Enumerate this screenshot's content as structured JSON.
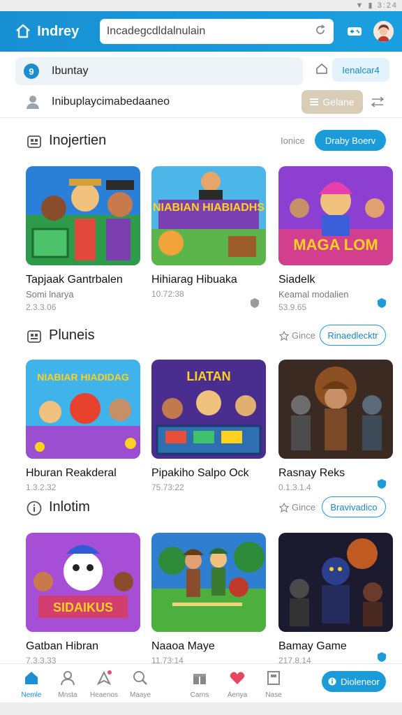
{
  "status_bar": {
    "time": "3:24"
  },
  "app_bar": {
    "title": "Indrey",
    "search_value": "Incadegcdldalnulain"
  },
  "filter": {
    "badge": "9",
    "label": "Ibuntay",
    "chip": "Ienalcar4"
  },
  "user_row": {
    "text": "Inibuplaycimabedaaneo",
    "sort_label": "Gelane"
  },
  "sections": [
    {
      "title": "Inojertien",
      "meta": "Ionice",
      "button": "Draby Boerv",
      "cards": [
        {
          "title": "Tapjaak Gantrbalen",
          "subtitle": "Somi lnarya",
          "number": "2.3.3.06",
          "art_text": ""
        },
        {
          "title": "Hihiarag Hibuaka",
          "subtitle": "",
          "number": "10.72:38",
          "art_text": "NIABIAN HIABIADHS"
        },
        {
          "title": "Siadelk",
          "subtitle": "Keamal modalien",
          "number": "53.9.65",
          "art_text": "MAGA LOM"
        }
      ]
    },
    {
      "title": "Pluneis",
      "meta": "Gince",
      "button": "Rinaedlecktr",
      "cards": [
        {
          "title": "Hburan Reakderal",
          "subtitle": "",
          "number": "1.3.2.32",
          "art_text": "NIABIAR HIADIDAG"
        },
        {
          "title": "Pipakiho Salpo Ock",
          "subtitle": "",
          "number": "75.73:22",
          "art_text": "LIATAN"
        },
        {
          "title": "Rasnay Reks",
          "subtitle": "",
          "number": "0.1.3.1.4",
          "art_text": ""
        }
      ]
    },
    {
      "title": "Inlotim",
      "meta": "Gince",
      "button": "Bravivadico",
      "cards": [
        {
          "title": "Gatban Hibran",
          "subtitle": "",
          "number": "7.3.3.33",
          "art_text": "SIDAIKUS"
        },
        {
          "title": "Naaoa Maye",
          "subtitle": "",
          "number": "11.73:14",
          "art_text": ""
        },
        {
          "title": "Bamay Game",
          "subtitle": "",
          "number": "217.8.14",
          "art_text": ""
        }
      ]
    }
  ],
  "bottom_nav": [
    {
      "label": "Nemle",
      "icon": "home-icon"
    },
    {
      "label": "Mnsta",
      "icon": "people-icon"
    },
    {
      "label": "Heaenos",
      "icon": "rocket-icon"
    },
    {
      "label": "Maaye",
      "icon": "search-icon"
    },
    {
      "label": "Carns",
      "icon": "gift-icon"
    },
    {
      "label": "Aenya",
      "icon": "heart-icon"
    },
    {
      "label": "Nase",
      "icon": "book-icon"
    }
  ],
  "bottom_button": "Dioleneor",
  "colors": {
    "primary": "#1b9bd8",
    "appbar": "#1790d3",
    "sort_chip": "#d9cdb8"
  }
}
